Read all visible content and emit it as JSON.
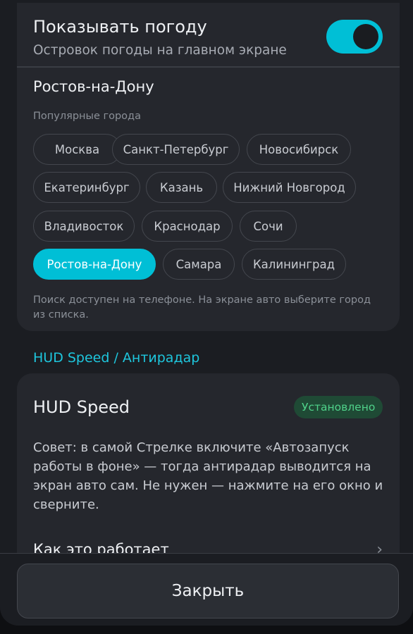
{
  "weather": {
    "title": "Показывать погоду",
    "subtitle": "Островок погоды на главном экране",
    "toggle_on": true,
    "city_title": "Ростов-на-Дону",
    "popular_label": "Популярные города",
    "cities": [
      {
        "label": "Москва",
        "active": false
      },
      {
        "label": "Санкт-Петербург",
        "active": false
      },
      {
        "label": "Новосибирск",
        "active": false
      },
      {
        "label": "Екатеринбург",
        "active": false
      },
      {
        "label": "Казань",
        "active": false
      },
      {
        "label": "Нижний Новгород",
        "active": false
      },
      {
        "label": "Владивосток",
        "active": false
      },
      {
        "label": "Краснодар",
        "active": false
      },
      {
        "label": "Сочи",
        "active": false
      },
      {
        "label": "Ростов-на-Дону",
        "active": true
      },
      {
        "label": "Самара",
        "active": false
      },
      {
        "label": "Калининград",
        "active": false
      }
    ],
    "hint": "Поиск доступен на телефоне. На экране авто выберите город из списка."
  },
  "hud_section": {
    "title": "HUD Speed / Антирадар"
  },
  "hud_card": {
    "title": "HUD Speed",
    "badge": "Установлено",
    "tip": "Совет: в самой Стрелке включите «Автозапуск работы в фоне» — тогда антирадар выводится на экран авто сам. Не нужен — нажмите на его окно и сверните.",
    "how_label": "Как это работает",
    "how_chevron": "›"
  },
  "footer": {
    "close_label": "Закрыть"
  },
  "colors": {
    "accent": "#00bfd6",
    "badge_bg": "#1f4a35",
    "badge_text": "#4fd28a"
  }
}
